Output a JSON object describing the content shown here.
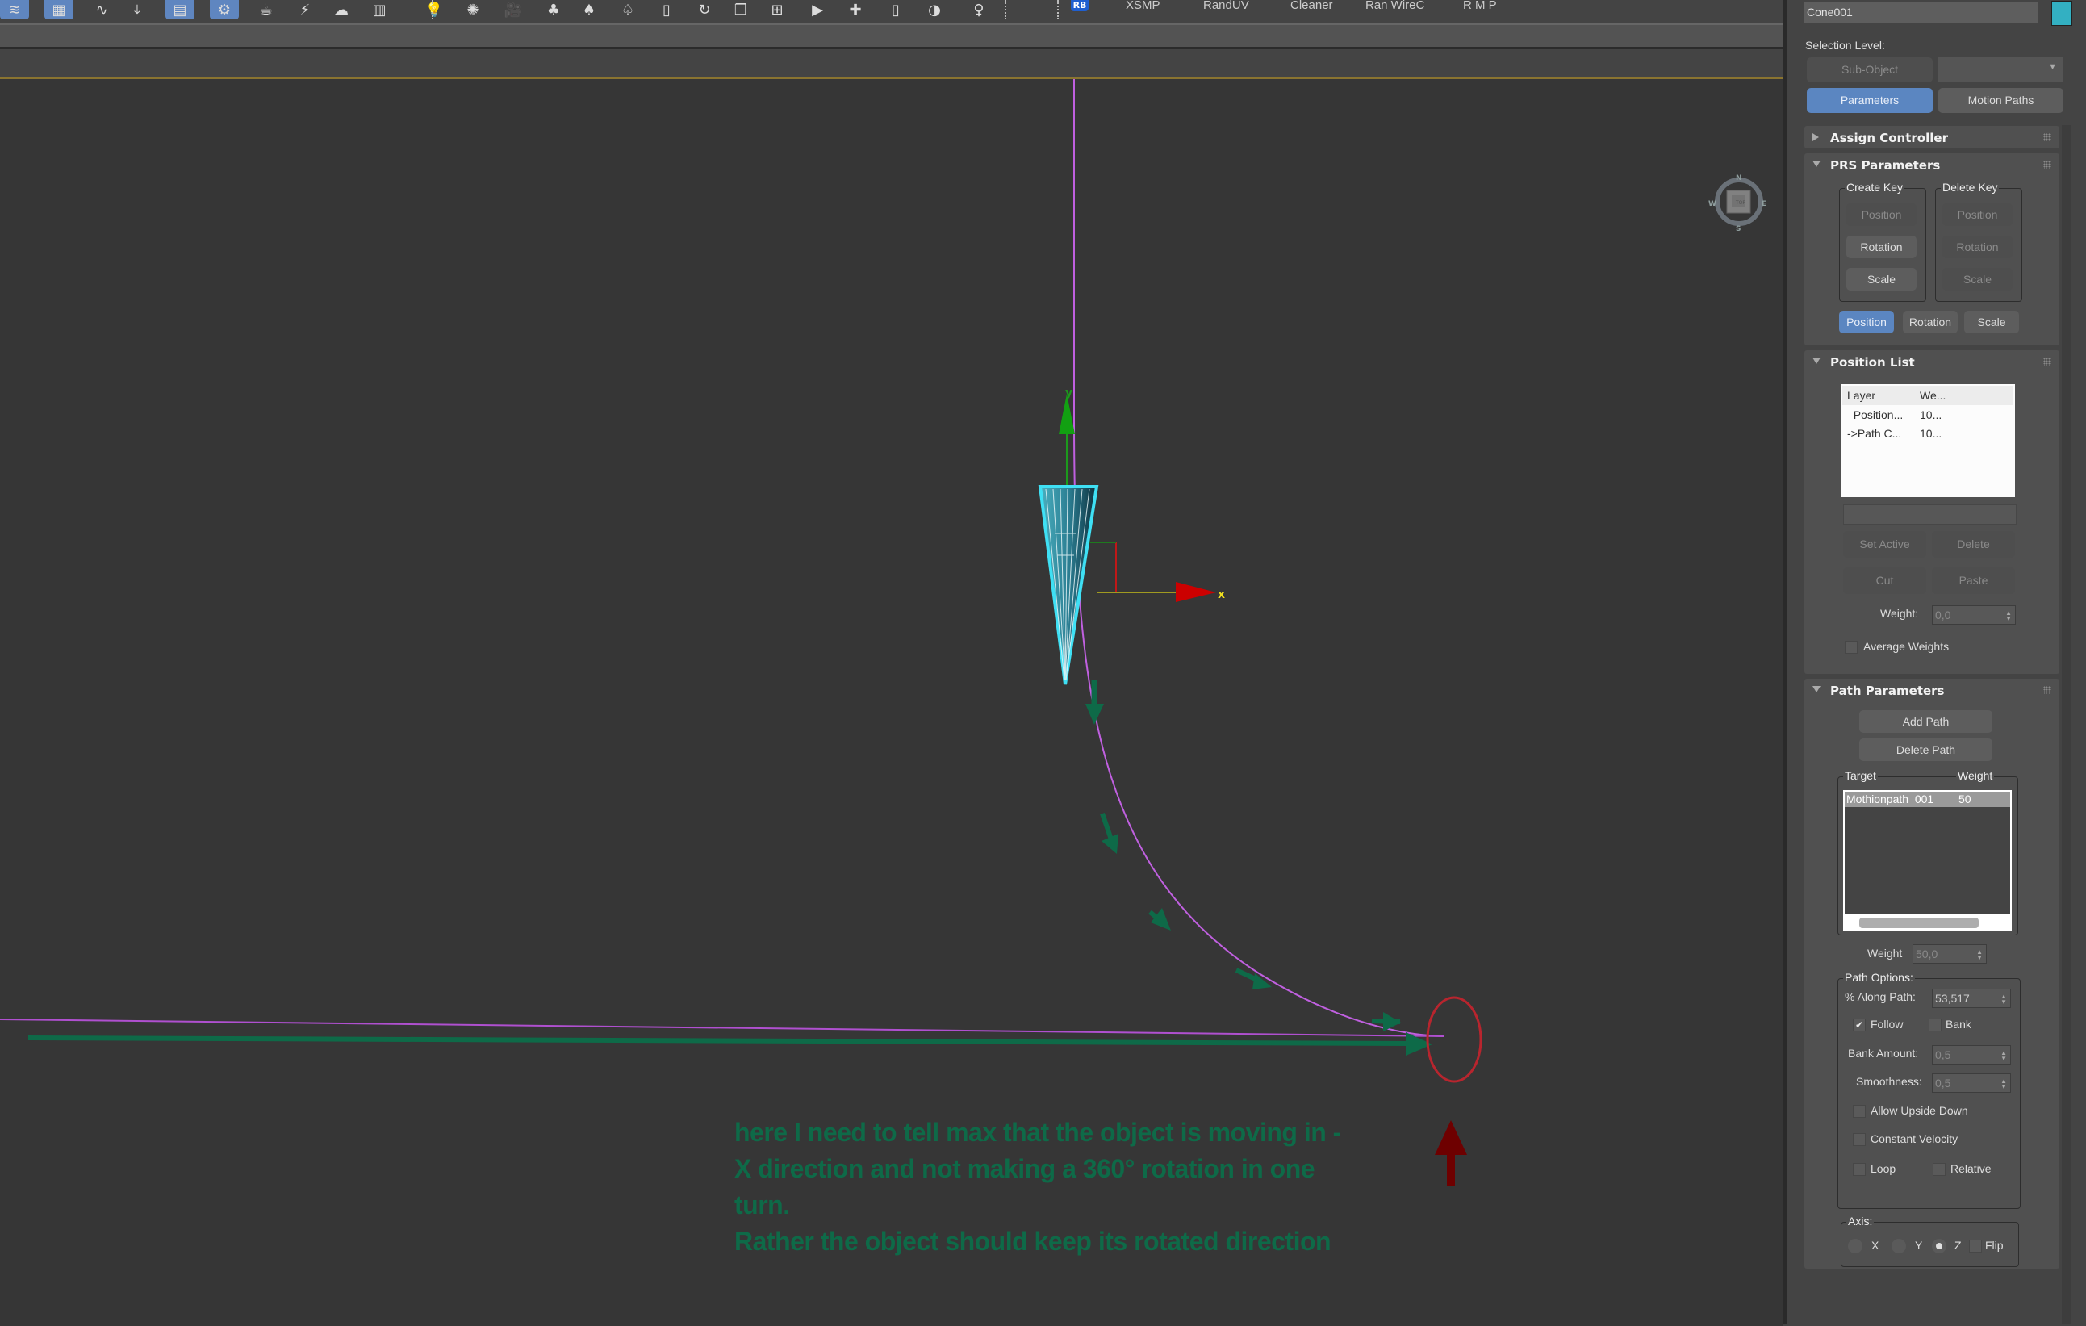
{
  "toolbar": {
    "icons": [
      {
        "name": "layers-icon",
        "glyph": "≋",
        "active": true
      },
      {
        "name": "scene-explorer-icon",
        "glyph": "▦",
        "active": true
      },
      {
        "name": "curve-editor-icon",
        "glyph": "∿",
        "active": false
      },
      {
        "name": "import-icon",
        "glyph": "⤓",
        "active": false
      },
      {
        "name": "material-editor-icon",
        "glyph": "▤",
        "active": true
      },
      {
        "name": "render-setup-icon",
        "glyph": "⚙",
        "active": true
      },
      {
        "name": "render-teapot-icon",
        "glyph": "☕",
        "active": false
      },
      {
        "name": "render-active-icon",
        "glyph": "⚡",
        "active": false
      },
      {
        "name": "render-cloud-icon",
        "glyph": "☁",
        "active": false
      },
      {
        "name": "render-frame-window-icon",
        "glyph": "▥",
        "active": false
      },
      {
        "name": "light-bulb-icon",
        "glyph": "💡",
        "active": false
      },
      {
        "name": "sun-icon",
        "glyph": "✺",
        "active": false
      },
      {
        "name": "camera-icon",
        "glyph": "🎥",
        "active": false
      },
      {
        "name": "tree-icon",
        "glyph": "♣",
        "active": false
      },
      {
        "name": "tree-list-icon",
        "glyph": "♠",
        "active": false
      },
      {
        "name": "tree-pattern-icon",
        "glyph": "♤",
        "active": false
      },
      {
        "name": "tree-doc-icon",
        "glyph": "▯",
        "active": false
      },
      {
        "name": "refresh-icon",
        "glyph": "↻",
        "active": false
      },
      {
        "name": "layers-stack-icon",
        "glyph": "❐",
        "active": false
      },
      {
        "name": "viewport-layout-icon",
        "glyph": "⊞",
        "active": false
      },
      {
        "name": "play-panel-icon",
        "glyph": "▶",
        "active": false
      },
      {
        "name": "camera-add-icon",
        "glyph": "✚",
        "active": false
      },
      {
        "name": "panel-icon",
        "glyph": "▯",
        "active": false
      },
      {
        "name": "helmet-icon",
        "glyph": "◑",
        "active": false
      },
      {
        "name": "lamp-icon",
        "glyph": "♀",
        "active": false
      }
    ],
    "rb_badge": "RB",
    "scripts": [
      "XSMP",
      "RandUV",
      "Cleaner",
      "Ran WireC",
      "R M P"
    ]
  },
  "viewport": {
    "gizmo_x_label": "x",
    "gizmo_y_label": "y",
    "compass": {
      "n": "N",
      "s": "S",
      "e": "E",
      "w": "W",
      "view": "TOP"
    },
    "annotation_lines": [
      "here I need to tell max that the object is moving in -",
      "X direction and not making a 360° rotation in one",
      "turn.",
      "Rather  the object should keep its rotated direction"
    ],
    "colors": {
      "path": "#c060e0",
      "annotation_green": "#0e6a48",
      "highlight_red": "#b8252e",
      "arrow_darkred": "#6e0000",
      "cone": "#3fd8ee"
    }
  },
  "panel": {
    "object_name": "Cone001",
    "object_color": "#33b0c2",
    "selection_level_label": "Selection Level:",
    "sub_object_button": "Sub-Object",
    "parameters_button": "Parameters",
    "motion_paths_button": "Motion Paths",
    "assign_controller": {
      "title": "Assign Controller"
    },
    "prs": {
      "title": "PRS Parameters",
      "create_key": {
        "label": "Create Key",
        "buttons": [
          "Position",
          "Rotation",
          "Scale"
        ]
      },
      "delete_key": {
        "label": "Delete Key",
        "buttons": [
          "Position",
          "Rotation",
          "Scale"
        ]
      },
      "tabs": [
        "Position",
        "Rotation",
        "Scale"
      ]
    },
    "position_list": {
      "title": "Position List",
      "columns": [
        "Layer",
        "We..."
      ],
      "rows": [
        {
          "layer": "  Position...",
          "weight": "10..."
        },
        {
          "layer": "->Path C...",
          "weight": "10..."
        }
      ],
      "set_active": "Set Active",
      "delete": "Delete",
      "cut": "Cut",
      "paste": "Paste",
      "weight_label": "Weight:",
      "weight_value": "0,0",
      "average_weights_label": "Average Weights",
      "average_weights_checked": false
    },
    "path_parameters": {
      "title": "Path Parameters",
      "add_path": "Add Path",
      "delete_path": "Delete Path",
      "target_label": "Target",
      "weight_col_label": "Weight",
      "targets": [
        {
          "name": "Mothionpath_001",
          "weight": "50"
        }
      ],
      "weight_label": "Weight",
      "weight_value": "50,0",
      "path_options_label": "Path Options:",
      "along_path_label": "% Along Path:",
      "along_path_value": "53,517",
      "follow_label": "Follow",
      "follow_checked": true,
      "bank_label": "Bank",
      "bank_checked": false,
      "bank_amount_label": "Bank Amount:",
      "bank_amount_value": "0,5",
      "smoothness_label": "Smoothness:",
      "smoothness_value": "0,5",
      "allow_upside_down_label": "Allow Upside Down",
      "constant_velocity_label": "Constant Velocity",
      "loop_label": "Loop",
      "relative_label": "Relative",
      "axis_label": "Axis:",
      "axis_options": [
        "X",
        "Y",
        "Z"
      ],
      "axis_selected": "Z",
      "flip_label": "Flip"
    }
  }
}
